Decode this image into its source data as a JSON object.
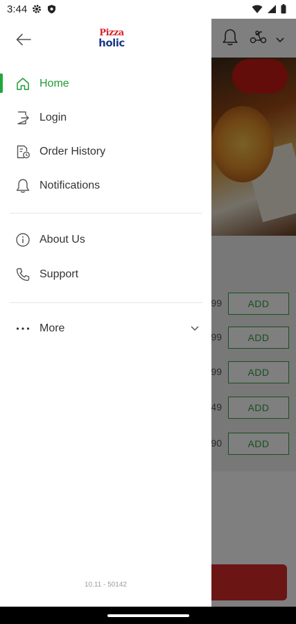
{
  "status_bar": {
    "time": "3:44",
    "left_icons": [
      "gear-icon",
      "shield-icon"
    ],
    "right_icons": [
      "wifi-icon",
      "signal-icon",
      "battery-icon"
    ]
  },
  "drawer": {
    "logo": {
      "line1": "Pizza",
      "line2": "holic"
    },
    "primary_items": [
      {
        "label": "Home",
        "icon": "home-icon",
        "active": true
      },
      {
        "label": "Login",
        "icon": "login-icon",
        "active": false
      },
      {
        "label": "Order History",
        "icon": "order-history-icon",
        "active": false
      },
      {
        "label": "Notifications",
        "icon": "bell-icon",
        "active": false
      }
    ],
    "secondary_items": [
      {
        "label": "About Us",
        "icon": "info-icon"
      },
      {
        "label": "Support",
        "icon": "phone-icon"
      }
    ],
    "more": {
      "label": "More",
      "icon": "more-dots-icon"
    },
    "version": "10.11 - 50142"
  },
  "background": {
    "price_fragments": [
      "99",
      "99",
      "99",
      "49",
      "90"
    ],
    "add_label": "ADD"
  },
  "colors": {
    "accent_green": "#1e9b36",
    "logo_red": "#d8232a",
    "logo_blue": "#1b3b8a",
    "cta_red": "#d82b2b"
  }
}
